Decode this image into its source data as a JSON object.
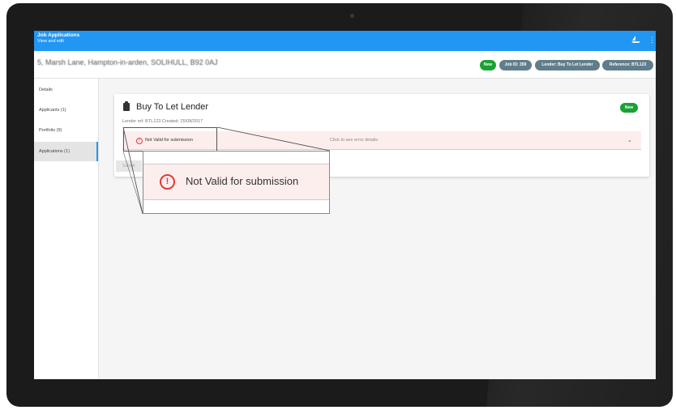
{
  "appbar": {
    "title": "Job Applications",
    "subtitle": "View and edit",
    "icons": [
      "boat-icon",
      "more-vert-icon"
    ]
  },
  "header": {
    "address": "5, Marsh Lane, Hampton-in-arden, SOLIHULL, B92 0AJ",
    "chips": [
      {
        "label": "New",
        "color": "#18a232"
      },
      {
        "label": "Job ID: 359",
        "color": "#607d8b"
      },
      {
        "label": "Lender: Buy To Let Lender",
        "color": "#607d8b"
      },
      {
        "label": "Reference: BTL123",
        "color": "#607d8b"
      }
    ]
  },
  "sidebar": {
    "items": [
      {
        "label": "Details"
      },
      {
        "label": "Applicants (1)"
      },
      {
        "label": "Portfolio (9)"
      },
      {
        "label": "Applications (1)",
        "active": true
      }
    ]
  },
  "card": {
    "title": "Buy To Let Lender",
    "subtitle": "Lender ref: BTL123 Created: 25/08/2017",
    "status_badge": "New",
    "error": {
      "text": "Not Valid for submission",
      "hint": "Click to see error details"
    },
    "submit_label": "Submit"
  },
  "zoom": {
    "text": "Not Valid for submission"
  },
  "colors": {
    "appbar": "#2196f3",
    "status_green": "#18a232",
    "chip_grey": "#607d8b",
    "error_red": "#e53935",
    "error_bg": "#fdeeee"
  }
}
